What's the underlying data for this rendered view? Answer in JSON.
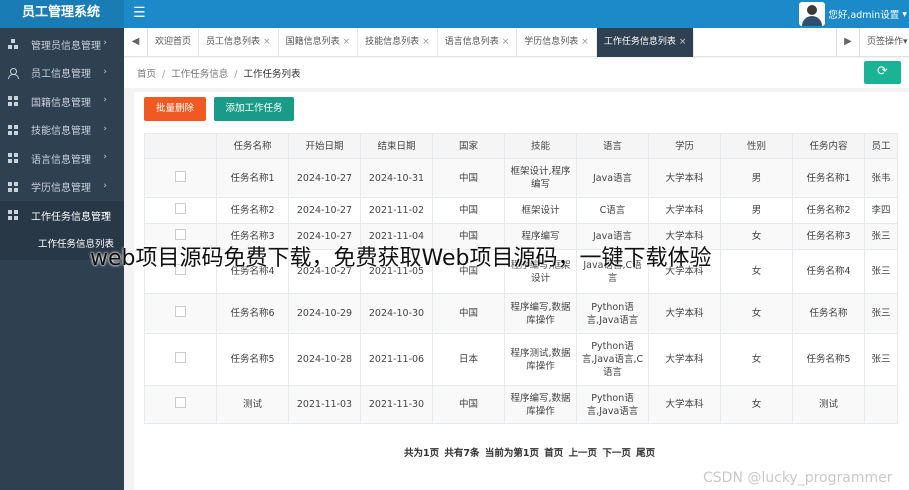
{
  "app": {
    "title": "员工管理系统",
    "menu_toggle_icon": "☰"
  },
  "user": {
    "greeting": "您好,admin设置",
    "dropdown_icon": "▾"
  },
  "sidebar": {
    "items": [
      {
        "label": "管理员信息管理",
        "icon": "tree-icon",
        "arrow": "›"
      },
      {
        "label": "员工信息管理",
        "icon": "person-icon",
        "arrow": "›"
      },
      {
        "label": "国籍信息管理",
        "icon": "grid-icon",
        "arrow": "›"
      },
      {
        "label": "技能信息管理",
        "icon": "grid-icon",
        "arrow": "›"
      },
      {
        "label": "语言信息管理",
        "icon": "grid-icon",
        "arrow": "›"
      },
      {
        "label": "学历信息管理",
        "icon": "grid-icon",
        "arrow": "›"
      },
      {
        "label": "工作任务信息管理",
        "icon": "grid-icon",
        "arrow": "⌄"
      }
    ],
    "submenu": [
      {
        "label": "工作任务信息列表"
      }
    ]
  },
  "tabs": {
    "nav_left": "◀",
    "nav_right": "▶",
    "close": "×",
    "items": [
      {
        "label": "欢迎首页"
      },
      {
        "label": "员工信息列表"
      },
      {
        "label": "国籍信息列表"
      },
      {
        "label": "技能信息列表"
      },
      {
        "label": "语言信息列表"
      },
      {
        "label": "学历信息列表"
      },
      {
        "label": "工作任务信息列表"
      }
    ],
    "page_ops": "页签操作▾"
  },
  "breadcrumb": {
    "items": [
      "首页",
      "工作任务信息",
      "工作任务列表"
    ],
    "sep": "/"
  },
  "refresh_icon": "⟳",
  "actions": {
    "batch_delete": "批量删除",
    "add": "添加工作任务"
  },
  "table": {
    "headers": [
      "",
      "任务名称",
      "开始日期",
      "结束日期",
      "国家",
      "技能",
      "语言",
      "学历",
      "性别",
      "任务内容",
      "员工"
    ],
    "rows": [
      [
        "",
        "任务名称1",
        "2024-10-27",
        "2024-10-31",
        "中国",
        "框架设计,程序编写",
        "Java语言",
        "大学本科",
        "男",
        "任务名称1",
        "张韦"
      ],
      [
        "",
        "任务名称2",
        "2024-10-27",
        "2021-11-02",
        "中国",
        "框架设计",
        "C语言",
        "大学本科",
        "男",
        "任务名称2",
        "李四"
      ],
      [
        "",
        "任务名称3",
        "2024-10-27",
        "2021-11-04",
        "中国",
        "程序编写",
        "Java语言",
        "大学本科",
        "女",
        "任务名称3",
        "张三"
      ],
      [
        "",
        "任务名称4",
        "2024-10-27",
        "2021-11-05",
        "中国",
        "程序编写,框架设计",
        "Java语言,C语言",
        "大学本科",
        "女",
        "任务名称4",
        "张三"
      ],
      [
        "",
        "任务名称6",
        "2024-10-29",
        "2024-10-30",
        "中国",
        "程序编写,数据库操作",
        "Python语言,Java语言",
        "大学本科",
        "女",
        "任务名称",
        "张三"
      ],
      [
        "",
        "任务名称5",
        "2024-10-28",
        "2021-11-06",
        "日本",
        "程序测试,数据库操作",
        "Python语言,Java语言,C语言",
        "大学本科",
        "女",
        "任务名称5",
        "张三"
      ],
      [
        "",
        "测试",
        "2021-11-03",
        "2021-11-30",
        "中国",
        "程序编写,数据库操作",
        "Python语言,Java语言",
        "大学本科",
        "女",
        "测试",
        ""
      ]
    ]
  },
  "pager": {
    "text": "共为1页 共有7条 当前为第1页 首页 上一页 下一页 尾页"
  },
  "overlay_text": "web项目源码免费下载，免费获取Web项目源码，一键下载体验",
  "watermark": "CSDN @lucky_programmer",
  "colors": {
    "header": "#1c8ac8",
    "sidebar": "#2f4050",
    "danger": "#f05a22",
    "primary": "#199b87",
    "refresh": "#1ab394"
  }
}
